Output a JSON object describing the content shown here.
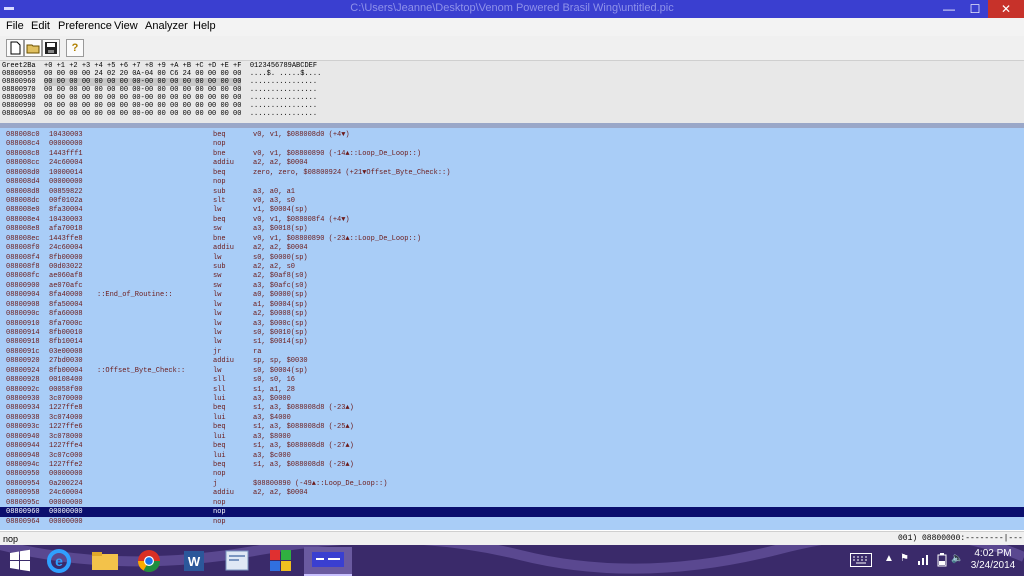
{
  "window": {
    "title": "C:\\Users\\Jeanne\\Desktop\\Venom Powered Brasil Wing\\untitled.pic",
    "min_label": "—",
    "max_label": "☐",
    "close_label": "✕"
  },
  "menu": [
    "File",
    "Edit",
    "Preference",
    "View",
    "Analyzer",
    "Help"
  ],
  "toolbar": {
    "help_glyph": "?"
  },
  "hex": {
    "header": "Greet2Ba  +0 +1 +2 +3 +4 +5 +6 +7 +8 +9 +A +B +C +D +E +F  0123456789ABCDEF",
    "rows": [
      {
        "addr": "08800950",
        "bytes": "00 00 00 00 24 02 20 0A-04 00 C6 24 00 00 00 00",
        "ascii": "....$. .....$...."
      },
      {
        "addr": "08800960",
        "bytes": "00 00 00 00 00 00 00 00-00 00 00 00 00 00 00 00",
        "ascii": "................"
      },
      {
        "addr": "08800970",
        "bytes": "00 00 00 00 00 00 00 00-00 00 00 00 00 00 00 00",
        "ascii": "................"
      },
      {
        "addr": "08800980",
        "bytes": "00 00 00 00 00 00 00 00-00 00 00 00 00 00 00 00",
        "ascii": "................"
      },
      {
        "addr": "08800990",
        "bytes": "00 00 00 00 00 00 00 00-00 00 00 00 00 00 00 00",
        "ascii": "................"
      },
      {
        "addr": "088009A0",
        "bytes": "00 00 00 00 00 00 00 00-00 00 00 00 00 00 00 00",
        "ascii": "................"
      }
    ]
  },
  "asm": [
    {
      "addr": "088008c0",
      "hex": "10430003",
      "label": "",
      "mn": "beq",
      "op": "v0, v1, $088008d0 (+4▼)"
    },
    {
      "addr": "088008c4",
      "hex": "00000000",
      "label": "",
      "mn": "nop",
      "op": ""
    },
    {
      "addr": "088008c8",
      "hex": "1443fff1",
      "label": "",
      "mn": "bne",
      "op": "v0, v1, $08800890 (-14▲::Loop_De_Loop::)"
    },
    {
      "addr": "088008cc",
      "hex": "24c60004",
      "label": "",
      "mn": "addiu",
      "op": "a2, a2, $0004"
    },
    {
      "addr": "088008d0",
      "hex": "10000014",
      "label": "",
      "mn": "beq",
      "op": "zero, zero, $08800924 (+21▼Offset_Byte_Check::)"
    },
    {
      "addr": "088008d4",
      "hex": "00000000",
      "label": "",
      "mn": "nop",
      "op": ""
    },
    {
      "addr": "088008d8",
      "hex": "00859822",
      "label": "",
      "mn": "sub",
      "op": "a3, a0, a1"
    },
    {
      "addr": "088008dc",
      "hex": "00f0102a",
      "label": "",
      "mn": "slt",
      "op": "v0, a3, s0"
    },
    {
      "addr": "088008e0",
      "hex": "8fa30004",
      "label": "",
      "mn": "lw",
      "op": "v1, $0004(sp)"
    },
    {
      "addr": "088008e4",
      "hex": "10430003",
      "label": "",
      "mn": "beq",
      "op": "v0, v1, $088008f4 (+4▼)"
    },
    {
      "addr": "088008e8",
      "hex": "afa70018",
      "label": "",
      "mn": "sw",
      "op": "a3, $0018(sp)"
    },
    {
      "addr": "088008ec",
      "hex": "1443ffe8",
      "label": "",
      "mn": "bne",
      "op": "v0, v1, $08800890 (-23▲::Loop_De_Loop::)"
    },
    {
      "addr": "088008f0",
      "hex": "24c60004",
      "label": "",
      "mn": "addiu",
      "op": "a2, a2, $0004"
    },
    {
      "addr": "088008f4",
      "hex": "8fb00000",
      "label": "",
      "mn": "lw",
      "op": "s0, $0000(sp)"
    },
    {
      "addr": "088008f8",
      "hex": "00d03022",
      "label": "",
      "mn": "sub",
      "op": "a2, a2, s0"
    },
    {
      "addr": "088008fc",
      "hex": "ae060af8",
      "label": "",
      "mn": "sw",
      "op": "a2, $0af8(s0)"
    },
    {
      "addr": "08800900",
      "hex": "ae070afc",
      "label": "",
      "mn": "sw",
      "op": "a3, $0afc(s0)"
    },
    {
      "addr": "08800904",
      "hex": "8fa40000",
      "label": "::End_of_Routine::",
      "mn": "lw",
      "op": "a0, $0000(sp)"
    },
    {
      "addr": "08800908",
      "hex": "8fa50004",
      "label": "",
      "mn": "lw",
      "op": "a1, $0004(sp)"
    },
    {
      "addr": "0880090c",
      "hex": "8fa60008",
      "label": "",
      "mn": "lw",
      "op": "a2, $0008(sp)"
    },
    {
      "addr": "08800910",
      "hex": "8fa7000c",
      "label": "",
      "mn": "lw",
      "op": "a3, $000c(sp)"
    },
    {
      "addr": "08800914",
      "hex": "8fb00010",
      "label": "",
      "mn": "lw",
      "op": "s0, $0010(sp)"
    },
    {
      "addr": "08800918",
      "hex": "8fb10014",
      "label": "",
      "mn": "lw",
      "op": "s1, $0014(sp)"
    },
    {
      "addr": "0880091c",
      "hex": "03e00008",
      "label": "",
      "mn": "jr",
      "op": "ra"
    },
    {
      "addr": "08800920",
      "hex": "27bd0030",
      "label": "",
      "mn": "addiu",
      "op": "sp, sp, $0030"
    },
    {
      "addr": "08800924",
      "hex": "8fb00004",
      "label": "::Offset_Byte_Check::",
      "mn": "lw",
      "op": "s0, $0004(sp)"
    },
    {
      "addr": "08800928",
      "hex": "00108400",
      "label": "",
      "mn": "sll",
      "op": "s0, s0, 16"
    },
    {
      "addr": "0880092c",
      "hex": "00058f00",
      "label": "",
      "mn": "sll",
      "op": "s1, a1, 28"
    },
    {
      "addr": "08800930",
      "hex": "3c070000",
      "label": "",
      "mn": "lui",
      "op": "a3, $0000"
    },
    {
      "addr": "08800934",
      "hex": "1227ffe8",
      "label": "",
      "mn": "beq",
      "op": "s1, a3, $088008d8 (-23▲)"
    },
    {
      "addr": "08800938",
      "hex": "3c074000",
      "label": "",
      "mn": "lui",
      "op": "a3, $4000"
    },
    {
      "addr": "0880093c",
      "hex": "1227ffe6",
      "label": "",
      "mn": "beq",
      "op": "s1, a3, $088008d8 (-25▲)"
    },
    {
      "addr": "08800940",
      "hex": "3c078000",
      "label": "",
      "mn": "lui",
      "op": "a3, $8000"
    },
    {
      "addr": "08800944",
      "hex": "1227ffe4",
      "label": "",
      "mn": "beq",
      "op": "s1, a3, $088008d8 (-27▲)"
    },
    {
      "addr": "08800948",
      "hex": "3c07c000",
      "label": "",
      "mn": "lui",
      "op": "a3, $c000"
    },
    {
      "addr": "0880094c",
      "hex": "1227ffe2",
      "label": "",
      "mn": "beq",
      "op": "s1, a3, $088008d8 (-29▲)"
    },
    {
      "addr": "08800950",
      "hex": "00000000",
      "label": "",
      "mn": "nop",
      "op": ""
    },
    {
      "addr": "08800954",
      "hex": "0a200224",
      "label": "",
      "mn": "j",
      "op": "$08800890 (-49▲::Loop_De_Loop::)"
    },
    {
      "addr": "08800958",
      "hex": "24c60004",
      "label": "",
      "mn": "addiu",
      "op": "a2, a2, $0004"
    },
    {
      "addr": "0880095c",
      "hex": "00000000",
      "label": "",
      "mn": "nop",
      "op": ""
    },
    {
      "addr": "08800960",
      "hex": "00000000",
      "label": "",
      "mn": "nop",
      "op": ""
    },
    {
      "addr": "08800964",
      "hex": "00000000",
      "label": "",
      "mn": "nop",
      "op": ""
    }
  ],
  "selected_row": 40,
  "status": {
    "left": "nop",
    "right": "001) 08800000:--------|--------"
  },
  "taskbar": {
    "time": "4:02 PM",
    "date": "3/24/2014"
  },
  "icons": {
    "start": "windows-start-icon",
    "ie": "internet-explorer-icon",
    "explorer": "file-explorer-icon",
    "chrome": "chrome-icon",
    "word": "word-icon",
    "keyboard": "touch-keyboard-icon"
  }
}
